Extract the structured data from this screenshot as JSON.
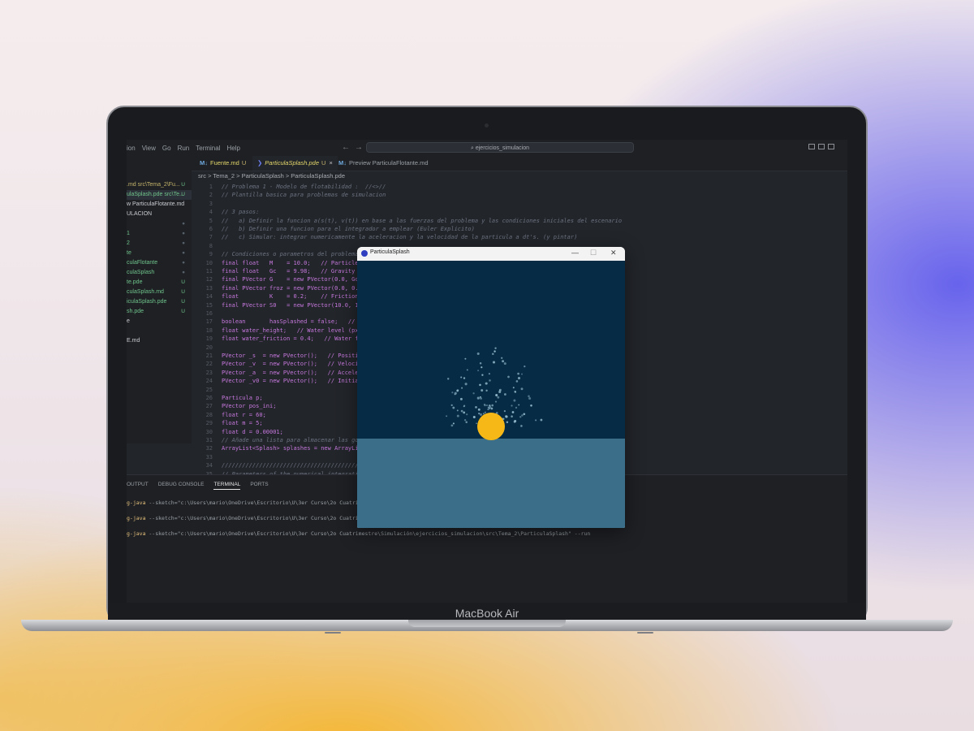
{
  "device_label": "MacBook Air",
  "vscode": {
    "menu": [
      "ion",
      "View",
      "Go",
      "Run",
      "Terminal",
      "Help"
    ],
    "search_text": "ejercicios_simulacion",
    "tabs": [
      {
        "icon": "M↓",
        "label": "Fuente.md",
        "status": "U"
      },
      {
        "icon": "",
        "label": "ParticulaSplash.pde",
        "status": "U",
        "close": "×"
      },
      {
        "icon": "M↓",
        "label": "Preview ParticulaFlotante.md"
      }
    ],
    "breadcrumb": "src > Tema_2 > ParticulaSplash > ParticulaSplash.pde",
    "sidebar_more": "···",
    "sidebar_items": [
      {
        "name": ".md  src\\Tema_2\\Fu...",
        "status": "U",
        "color": "#c4b36a"
      },
      {
        "name": "ulaSplash.pde  src\\Te...",
        "status": "U",
        "color": "#6fc38b"
      },
      {
        "name": "w ParticulaFlotante.md",
        "status": "",
        "color": "#c9ccd1"
      },
      {
        "name": "ULACION",
        "status": "",
        "color": "#c9ccd1"
      },
      {
        "name": "",
        "status": "●",
        "color": "#6fc38b"
      },
      {
        "name": "1",
        "status": "●",
        "color": "#6fc38b"
      },
      {
        "name": "2",
        "status": "●",
        "color": "#6fc38b"
      },
      {
        "name": "te",
        "status": "●",
        "color": "#6fc38b"
      },
      {
        "name": "culaFlotante",
        "status": "●",
        "color": "#6fc38b"
      },
      {
        "name": "culaSplash",
        "status": "●",
        "color": "#6fc38b"
      },
      {
        "name": "te.pde",
        "status": "U",
        "color": "#6fc38b"
      },
      {
        "name": "culaSplash.md",
        "status": "U",
        "color": "#6fc38b"
      },
      {
        "name": "iculaSplash.pde",
        "status": "U",
        "color": "#6fc38b"
      },
      {
        "name": "sh.pde",
        "status": "U",
        "color": "#6fc38b"
      },
      {
        "name": "e",
        "status": "",
        "color": "#c9ccd1"
      },
      {
        "name": "",
        "status": "",
        "color": "#c9ccd1"
      },
      {
        "name": "E.md",
        "status": "",
        "color": "#c9ccd1"
      }
    ],
    "code_lines": [
      {
        "n": "1",
        "t": "// Problema 1 - Modelo de flotabilidad :  //<>//",
        "k": "com"
      },
      {
        "n": "2",
        "t": "// Plantilla basica para problemas de simulacion",
        "k": "com"
      },
      {
        "n": "3",
        "t": "",
        "k": ""
      },
      {
        "n": "4",
        "t": "// 3 pasos:",
        "k": "com"
      },
      {
        "n": "5",
        "t": "//   a) Definir la funcion a(s(t), v(t)) en base a las fuerzas del problema y las condiciones iniciales del escenario",
        "k": "com"
      },
      {
        "n": "6",
        "t": "//   b) Definir una funcion para el integrador a emplear (Euler Explicito)",
        "k": "com"
      },
      {
        "n": "7",
        "t": "//   c) Simular: integrar numericamente la aceleracion y la velocidad de la particula a dt's. (y pintar)",
        "k": "com"
      },
      {
        "n": "8",
        "t": "",
        "k": ""
      },
      {
        "n": "9",
        "t": "// Condiciones o parametros del problema",
        "k": "com"
      },
      {
        "n": "10",
        "t": "final float   M    = 10.0;   // Particle mass",
        "k": "code"
      },
      {
        "n": "11",
        "t": "final float   Gc   = 9.98;   // Gravity constant",
        "k": "code"
      },
      {
        "n": "12",
        "t": "final PVector G    = new PVector(0.0, Gc);",
        "k": "code"
      },
      {
        "n": "13",
        "t": "final PVector froz = new PVector(0.0, 0.0);",
        "k": "code"
      },
      {
        "n": "14",
        "t": "float         K    = 0.2;    // Friction",
        "k": "code"
      },
      {
        "n": "15",
        "t": "final PVector S0   = new PVector(10.0, 10.0);",
        "k": "code"
      },
      {
        "n": "16",
        "t": "",
        "k": ""
      },
      {
        "n": "17",
        "t": "boolean       hasSplashed = false;   //",
        "k": "code"
      },
      {
        "n": "18",
        "t": "float water_height;   // Water level (px)",
        "k": "code"
      },
      {
        "n": "19",
        "t": "float water_friction = 0.4;   // Water friction",
        "k": "code"
      },
      {
        "n": "20",
        "t": "",
        "k": ""
      },
      {
        "n": "21",
        "t": "PVector _s  = new PVector();   // Position",
        "k": "code"
      },
      {
        "n": "22",
        "t": "PVector _v  = new PVector();   // Velocity",
        "k": "code"
      },
      {
        "n": "23",
        "t": "PVector _a  = new PVector();   // Acceleration",
        "k": "code"
      },
      {
        "n": "24",
        "t": "PVector _v0 = new PVector();   // Initial velocity",
        "k": "code"
      },
      {
        "n": "25",
        "t": "",
        "k": ""
      },
      {
        "n": "26",
        "t": "Particula p;",
        "k": "code"
      },
      {
        "n": "27",
        "t": "PVector pos_ini;",
        "k": "code"
      },
      {
        "n": "28",
        "t": "float r = 60;",
        "k": "code"
      },
      {
        "n": "29",
        "t": "float m = 5;",
        "k": "code"
      },
      {
        "n": "30",
        "t": "float d = 0.00001;",
        "k": "code"
      },
      {
        "n": "31",
        "t": "// Añade una lista para almacenar las gotas",
        "k": "com"
      },
      {
        "n": "32",
        "t": "ArrayList<Splash> splashes = new ArrayList<Splash>();",
        "k": "code"
      },
      {
        "n": "33",
        "t": "",
        "k": ""
      },
      {
        "n": "34",
        "t": "//////////////////////////////////////////",
        "k": "com"
      },
      {
        "n": "35",
        "t": "// Parameters of the numerical integration",
        "k": "com"
      }
    ],
    "panel_tabs": [
      "OUTPUT",
      "DEBUG CONSOLE",
      "TERMINAL",
      "PORTS"
    ],
    "active_panel_tab": "TERMINAL",
    "terminal_lines": [
      {
        "cmd": "g-java",
        "rest": " --sketch=\"c:\\Users\\mario\\OneDrive\\Escritorio\\U\\3er Curso\\2o Cuatrimestre\\Simulación\\ejercicios_simulacion\\src\\Tema_2\\ParticulaSplash\" --run"
      },
      {
        "cmd": "g-java",
        "rest": " --sketch=\"c:\\Users\\mario\\OneDrive\\Escritorio\\U\\3er Curso\\2o Cuatrimestre\\Simulación\\ejercicios_simulacion\\src\\Tema_2\\ParticulaSplash\" --run"
      },
      {
        "cmd": "g-java",
        "rest": " --sketch=\"c:\\Users\\mario\\OneDrive\\Escritorio\\U\\3er Curso\\2o Cuatrimestre\\Simulación\\ejercicios_simulacion\\src\\Tema_2\\ParticulaSplash\" --run"
      }
    ]
  },
  "sketch_window": {
    "title": "ParticulaSplash",
    "minimize": "—",
    "maximize": "☐",
    "close": "✕",
    "colors": {
      "sky": "#062b45",
      "water": "#3b6e88",
      "ball": "#f6b816",
      "drops": "#8fb6c8"
    }
  }
}
